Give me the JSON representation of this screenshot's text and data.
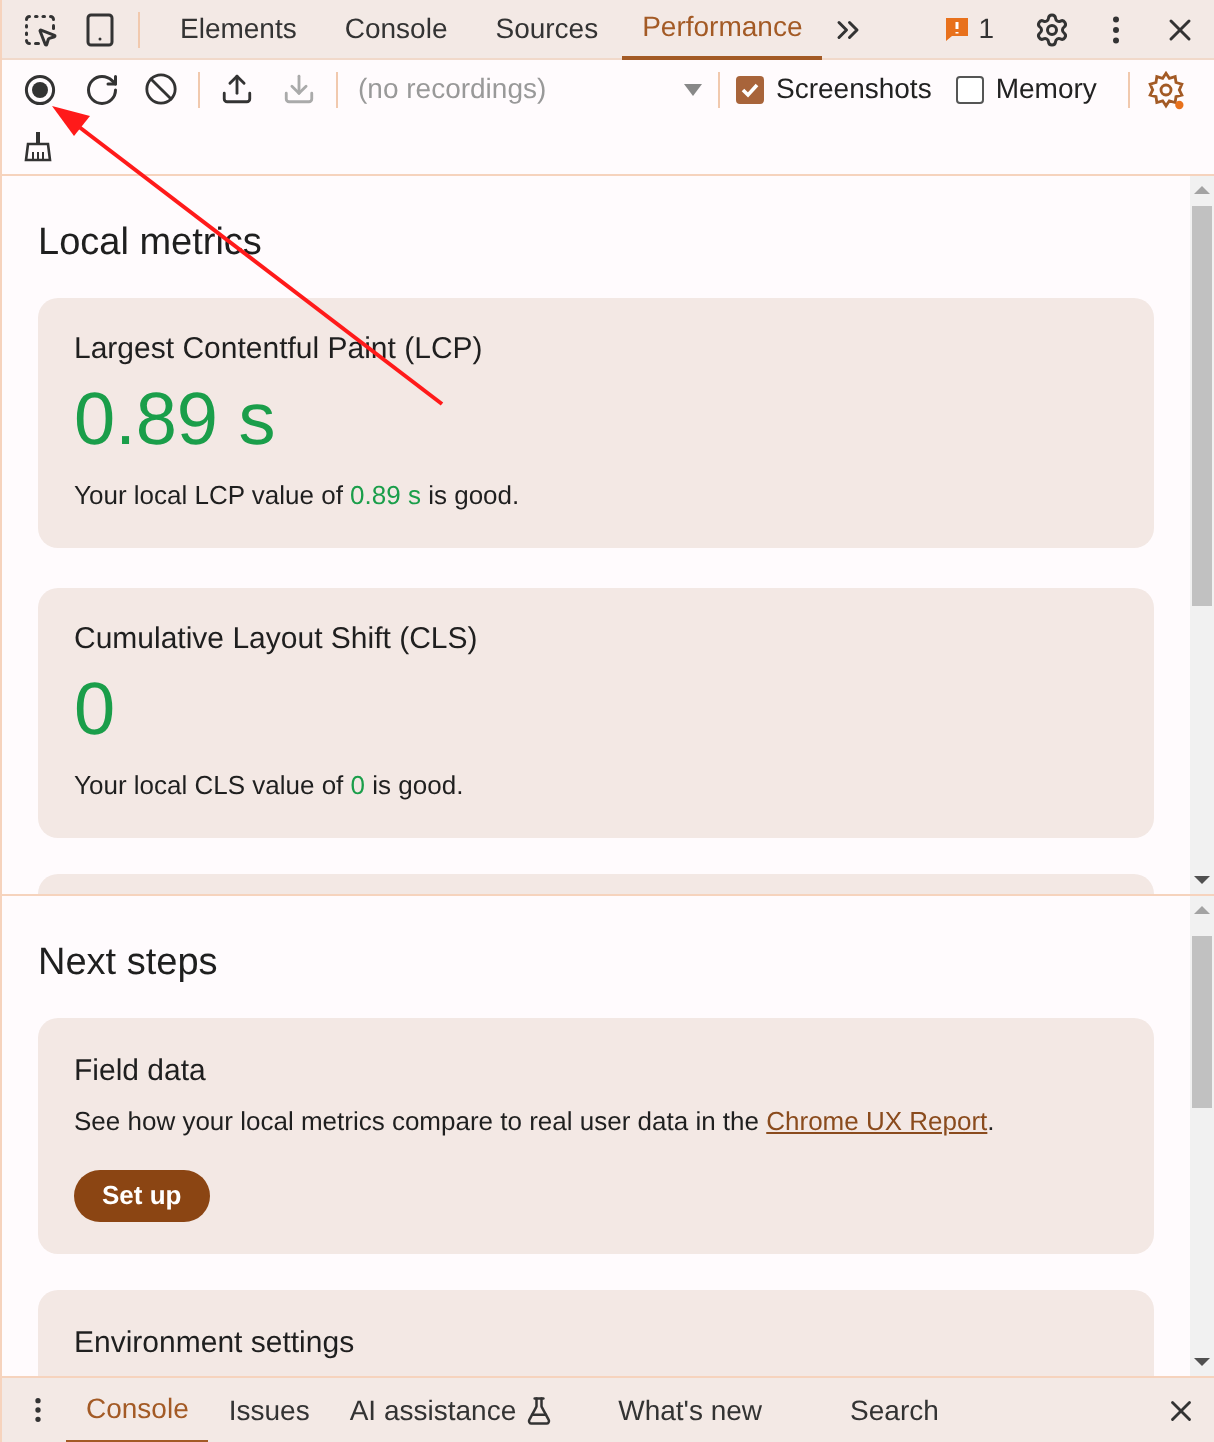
{
  "main_tabs": [
    {
      "label": "Elements",
      "selected": false
    },
    {
      "label": "Console",
      "selected": false
    },
    {
      "label": "Sources",
      "selected": false
    },
    {
      "label": "Performance",
      "selected": true
    }
  ],
  "issues_badge": {
    "count": "1"
  },
  "recording_select": {
    "placeholder": "(no recordings)"
  },
  "options": [
    {
      "label": "Screenshots",
      "checked": true
    },
    {
      "label": "Memory",
      "checked": false
    }
  ],
  "local_metrics": {
    "title": "Local metrics",
    "metrics": [
      {
        "name": "Largest Contentful Paint (LCP)",
        "value": "0.89 s",
        "color": "#1a9e4a",
        "summary_before": "Your local LCP value of ",
        "summary_value": "0.89 s",
        "summary_middle": " is ",
        "status": "good",
        "summary_end": "."
      },
      {
        "name": "Cumulative Layout Shift (CLS)",
        "value": "0",
        "color": "#1a9e4a",
        "summary_before": "Your local CLS value of ",
        "summary_value": "0",
        "summary_middle": " is ",
        "status": "good",
        "summary_end": "."
      }
    ]
  },
  "next_steps": {
    "title": "Next steps",
    "cards": [
      {
        "title": "Field data",
        "text_before": "See how your local metrics compare to real user data in the ",
        "link": "Chrome UX Report",
        "text_after": ".",
        "button": "Set up"
      },
      {
        "title": "Environment settings"
      }
    ]
  },
  "drawer_tabs": [
    {
      "label": "Console",
      "selected": true,
      "kind": "plain"
    },
    {
      "label": "Issues",
      "selected": false,
      "kind": "plain"
    },
    {
      "label": "AI assistance",
      "selected": false,
      "kind": "experimental"
    },
    {
      "label": "What's new",
      "selected": false,
      "kind": "plain"
    },
    {
      "label": "Search",
      "selected": false,
      "kind": "plain"
    }
  ]
}
